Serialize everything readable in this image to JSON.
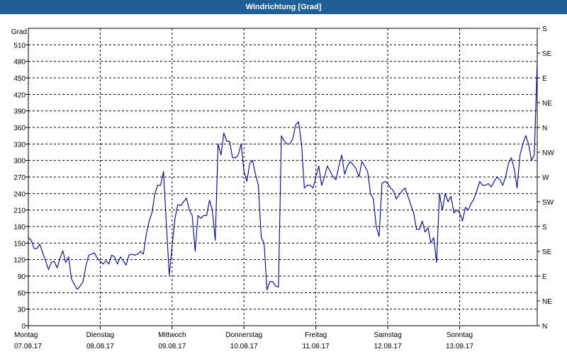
{
  "chart_data": {
    "type": "line",
    "title": "Windrichtung [Grad]",
    "ylabel": "Grad",
    "ylim": [
      0,
      540
    ],
    "y_ticks": [
      0,
      30,
      60,
      90,
      120,
      150,
      180,
      210,
      240,
      270,
      300,
      330,
      360,
      390,
      420,
      450,
      480,
      510
    ],
    "right_axis_labels": [
      "N",
      "NE",
      "E",
      "SE",
      "S",
      "SW",
      "W",
      "NW",
      "N",
      "NE",
      "E",
      "SE",
      "S"
    ],
    "right_axis_values": [
      0,
      45,
      90,
      135,
      180,
      225,
      270,
      315,
      360,
      405,
      450,
      495,
      540
    ],
    "x_days": [
      {
        "day": "Montag",
        "date": "07.08.17"
      },
      {
        "day": "Dienstag",
        "date": "08.08.17"
      },
      {
        "day": "Mittwoch",
        "date": "09.08.17"
      },
      {
        "day": "Donnerstag",
        "date": "10.08.17"
      },
      {
        "day": "Freitag",
        "date": "11.08.17"
      },
      {
        "day": "Samstag",
        "date": "12.08.17"
      },
      {
        "day": "Sonntag",
        "date": "13.08.17"
      }
    ],
    "grid": true,
    "line_color": "#00008b",
    "series": [
      {
        "x_days": [
          0.0,
          0.04,
          0.08,
          0.12,
          0.16,
          0.2,
          0.24,
          0.28,
          0.32,
          0.36,
          0.4,
          0.44,
          0.48,
          0.52,
          0.56,
          0.6,
          0.64,
          0.68,
          0.72,
          0.76,
          0.8,
          0.84,
          0.88,
          0.92,
          0.96,
          1.0,
          1.04,
          1.08,
          1.12,
          1.16,
          1.2,
          1.24,
          1.28,
          1.32,
          1.36,
          1.4,
          1.44,
          1.48,
          1.52,
          1.56,
          1.6,
          1.64,
          1.68,
          1.72,
          1.76,
          1.8,
          1.84,
          1.88,
          1.92,
          1.96,
          2.0,
          2.04,
          2.08,
          2.12,
          2.16,
          2.2,
          2.24,
          2.28,
          2.32,
          2.36,
          2.4,
          2.44,
          2.48,
          2.52,
          2.56,
          2.6,
          2.64,
          2.68,
          2.72,
          2.76,
          2.8,
          2.84,
          2.88,
          2.92,
          2.96,
          3.0,
          3.04,
          3.08,
          3.12,
          3.16,
          3.2,
          3.24,
          3.28,
          3.32,
          3.36,
          3.4,
          3.44,
          3.48,
          3.52,
          3.56,
          3.6,
          3.64,
          3.68,
          3.72,
          3.76,
          3.8,
          3.84,
          3.88,
          3.92,
          3.96,
          4.0,
          4.04,
          4.08,
          4.12,
          4.16,
          4.2,
          4.24,
          4.28,
          4.32,
          4.36,
          4.4,
          4.44,
          4.48,
          4.52,
          4.56,
          4.6,
          4.64,
          4.68,
          4.72,
          4.76,
          4.8,
          4.84,
          4.88,
          4.92,
          4.96,
          5.0,
          5.04,
          5.08,
          5.12,
          5.16,
          5.2,
          5.24,
          5.28,
          5.32,
          5.36,
          5.4,
          5.44,
          5.48,
          5.52,
          5.56,
          5.6,
          5.64,
          5.68,
          5.72,
          5.76,
          5.8,
          5.84,
          5.88,
          5.92,
          5.96,
          6.0,
          6.04,
          6.08,
          6.12,
          6.16,
          6.2,
          6.24,
          6.28,
          6.32,
          6.36,
          6.4,
          6.44,
          6.48,
          6.52,
          6.56,
          6.6,
          6.64,
          6.68,
          6.72,
          6.76,
          6.8,
          6.84,
          6.88,
          6.92,
          6.96,
          7.0,
          7.04,
          7.08
        ],
        "values": [
          160,
          155,
          140,
          140,
          148,
          132,
          118,
          102,
          115,
          117,
          105,
          122,
          136,
          115,
          125,
          85,
          75,
          66,
          72,
          80,
          108,
          128,
          130,
          132,
          122,
          117,
          112,
          118,
          112,
          128,
          125,
          112,
          125,
          118,
          110,
          128,
          130,
          128,
          130,
          135,
          130,
          165,
          190,
          205,
          240,
          255,
          255,
          280,
          185,
          92,
          145,
          195,
          220,
          218,
          225,
          232,
          210,
          200,
          135,
          200,
          195,
          200,
          200,
          228,
          210,
          155,
          330,
          310,
          350,
          335,
          335,
          305,
          305,
          310,
          330,
          280,
          262,
          295,
          300,
          275,
          255,
          160,
          150,
          65,
          80,
          80,
          72,
          70,
          345,
          335,
          330,
          330,
          340,
          365,
          370,
          330,
          250,
          255,
          255,
          250,
          270,
          290,
          255,
          270,
          290,
          280,
          270,
          265,
          290,
          310,
          275,
          290,
          298,
          292,
          285,
          270,
          298,
          290,
          280,
          240,
          230,
          180,
          162,
          258,
          262,
          258,
          250,
          245,
          230,
          238,
          245,
          250,
          235,
          220,
          205,
          175,
          175,
          190,
          170,
          178,
          150,
          160,
          115,
          240,
          210,
          240,
          225,
          235,
          205,
          210,
          205,
          190,
          215,
          210,
          222,
          230,
          245,
          262,
          255,
          255,
          258,
          252,
          262,
          270,
          265,
          255,
          270,
          295,
          305,
          285,
          250,
          310,
          330,
          345,
          330,
          300,
          310,
          480,
          508
        ]
      }
    ]
  }
}
